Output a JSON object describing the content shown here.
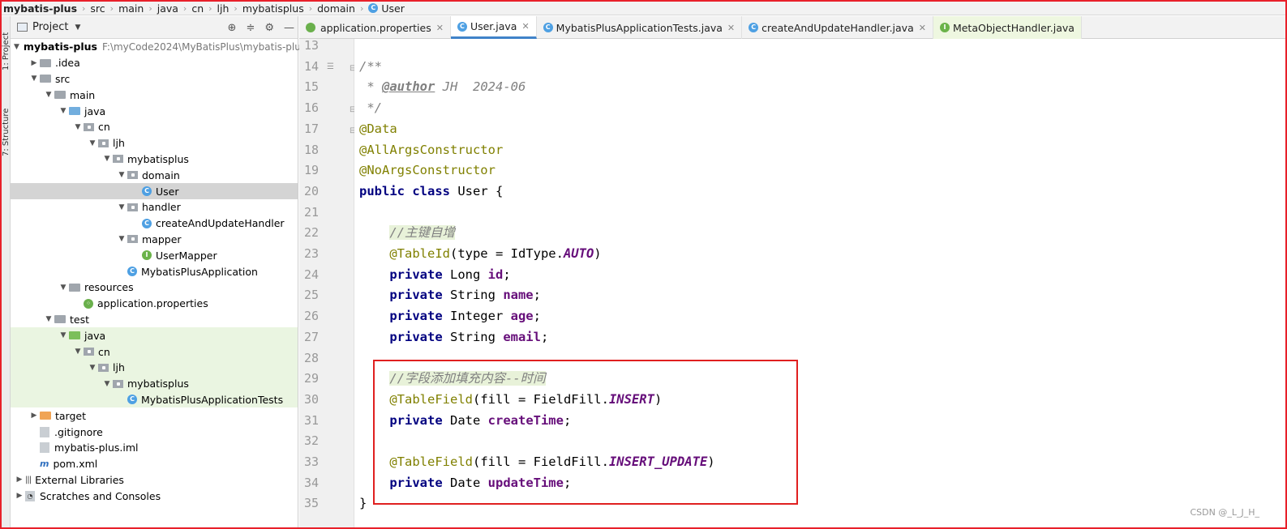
{
  "breadcrumb": [
    {
      "label": "mybatis-plus",
      "bold": true
    },
    {
      "label": "src"
    },
    {
      "label": "main"
    },
    {
      "label": "java"
    },
    {
      "label": "cn"
    },
    {
      "label": "ljh"
    },
    {
      "label": "mybatisplus"
    },
    {
      "label": "domain"
    },
    {
      "label": "User",
      "icon": "C"
    }
  ],
  "side_tabs": {
    "project": "1: Project",
    "structure": "7: Structure"
  },
  "project_panel": {
    "title": "Project",
    "tree": [
      {
        "label": "mybatis-plus",
        "hint": "F:\\myCode2024\\MyBatisPlus\\mybatis-plu",
        "depth": 0,
        "expand": "open",
        "icon": "folder",
        "bold": true
      },
      {
        "label": ".idea",
        "depth": 1,
        "expand": "closed",
        "icon": "folder"
      },
      {
        "label": "src",
        "depth": 1,
        "expand": "open",
        "icon": "folder"
      },
      {
        "label": "main",
        "depth": 2,
        "expand": "open",
        "icon": "folder"
      },
      {
        "label": "java",
        "depth": 3,
        "expand": "open",
        "icon": "folder-src"
      },
      {
        "label": "cn",
        "depth": 4,
        "expand": "open",
        "icon": "package"
      },
      {
        "label": "ljh",
        "depth": 5,
        "expand": "open",
        "icon": "package"
      },
      {
        "label": "mybatisplus",
        "depth": 6,
        "expand": "open",
        "icon": "package"
      },
      {
        "label": "domain",
        "depth": 7,
        "expand": "open",
        "icon": "package"
      },
      {
        "label": "User",
        "depth": 8,
        "expand": "none",
        "icon": "class",
        "selected": true
      },
      {
        "label": "handler",
        "depth": 7,
        "expand": "open",
        "icon": "package"
      },
      {
        "label": "createAndUpdateHandler",
        "depth": 8,
        "expand": "none",
        "icon": "class"
      },
      {
        "label": "mapper",
        "depth": 7,
        "expand": "open",
        "icon": "package"
      },
      {
        "label": "UserMapper",
        "depth": 8,
        "expand": "none",
        "icon": "interface"
      },
      {
        "label": "MybatisPlusApplication",
        "depth": 7,
        "expand": "none",
        "icon": "spring-class"
      },
      {
        "label": "resources",
        "depth": 3,
        "expand": "open",
        "icon": "folder-res"
      },
      {
        "label": "application.properties",
        "depth": 4,
        "expand": "none",
        "icon": "properties"
      },
      {
        "label": "test",
        "depth": 2,
        "expand": "open",
        "icon": "folder"
      },
      {
        "label": "java",
        "depth": 3,
        "expand": "open",
        "icon": "folder-test",
        "testbg": true
      },
      {
        "label": "cn",
        "depth": 4,
        "expand": "open",
        "icon": "package",
        "testbg": true
      },
      {
        "label": "ljh",
        "depth": 5,
        "expand": "open",
        "icon": "package",
        "testbg": true
      },
      {
        "label": "mybatisplus",
        "depth": 6,
        "expand": "open",
        "icon": "package",
        "testbg": true
      },
      {
        "label": "MybatisPlusApplicationTests",
        "depth": 7,
        "expand": "none",
        "icon": "spring-class",
        "testbg": true
      },
      {
        "label": "target",
        "depth": 1,
        "expand": "closed",
        "icon": "folder-target"
      },
      {
        "label": ".gitignore",
        "depth": 1,
        "expand": "none",
        "icon": "file"
      },
      {
        "label": "mybatis-plus.iml",
        "depth": 1,
        "expand": "none",
        "icon": "file"
      },
      {
        "label": "pom.xml",
        "depth": 1,
        "expand": "none",
        "icon": "maven"
      },
      {
        "label": "External Libraries",
        "depth": 0,
        "expand": "closed",
        "icon": "library"
      },
      {
        "label": "Scratches and Consoles",
        "depth": 0,
        "expand": "closed",
        "icon": "scratch"
      }
    ]
  },
  "editor_tabs": [
    {
      "label": "application.properties",
      "icon": "properties",
      "active": false
    },
    {
      "label": "User.java",
      "icon": "C",
      "active": true
    },
    {
      "label": "MybatisPlusApplicationTests.java",
      "icon": "C",
      "active": false
    },
    {
      "label": "createAndUpdateHandler.java",
      "icon": "C",
      "active": false
    },
    {
      "label": "MetaObjectHandler.java",
      "icon": "I",
      "active": false,
      "green": true
    }
  ],
  "line_numbers": [
    "13",
    "14",
    "15",
    "16",
    "17",
    "18",
    "19",
    "20",
    "21",
    "22",
    "23",
    "24",
    "25",
    "26",
    "27",
    "28",
    "29",
    "30",
    "31",
    "32",
    "33",
    "34",
    "35"
  ],
  "code_lines": [
    [],
    [
      {
        "t": "/**",
        "c": "cmt"
      }
    ],
    [
      {
        "t": " * ",
        "c": "cmt"
      },
      {
        "t": "@author",
        "c": "tag"
      },
      {
        "t": " JH  2024-06",
        "c": "cmt"
      }
    ],
    [
      {
        "t": " */",
        "c": "cmt"
      }
    ],
    [
      {
        "t": "@Data",
        "c": "ann"
      }
    ],
    [
      {
        "t": "@AllArgsConstructor",
        "c": "ann"
      }
    ],
    [
      {
        "t": "@NoArgsConstructor",
        "c": "ann"
      }
    ],
    [
      {
        "t": "public class ",
        "c": "kw"
      },
      {
        "t": "User {",
        "c": ""
      }
    ],
    [],
    [
      {
        "t": "    ",
        "c": ""
      },
      {
        "t": "//主键自增",
        "c": "cmt cmt-hl"
      }
    ],
    [
      {
        "t": "    ",
        "c": ""
      },
      {
        "t": "@TableId",
        "c": "ann"
      },
      {
        "t": "(type = IdType.",
        "c": ""
      },
      {
        "t": "AUTO",
        "c": "const"
      },
      {
        "t": ")",
        "c": ""
      }
    ],
    [
      {
        "t": "    ",
        "c": ""
      },
      {
        "t": "private ",
        "c": "kw"
      },
      {
        "t": "Long ",
        "c": ""
      },
      {
        "t": "id",
        "c": "fld"
      },
      {
        "t": ";",
        "c": ""
      }
    ],
    [
      {
        "t": "    ",
        "c": ""
      },
      {
        "t": "private ",
        "c": "kw"
      },
      {
        "t": "String ",
        "c": ""
      },
      {
        "t": "name",
        "c": "fld"
      },
      {
        "t": ";",
        "c": ""
      }
    ],
    [
      {
        "t": "    ",
        "c": ""
      },
      {
        "t": "private ",
        "c": "kw"
      },
      {
        "t": "Integer ",
        "c": ""
      },
      {
        "t": "age",
        "c": "fld"
      },
      {
        "t": ";",
        "c": ""
      }
    ],
    [
      {
        "t": "    ",
        "c": ""
      },
      {
        "t": "private ",
        "c": "kw"
      },
      {
        "t": "String ",
        "c": ""
      },
      {
        "t": "email",
        "c": "fld"
      },
      {
        "t": ";",
        "c": ""
      }
    ],
    [],
    [
      {
        "t": "    ",
        "c": ""
      },
      {
        "t": "//字段添加填充内容--时间",
        "c": "cmt cmt-hl"
      }
    ],
    [
      {
        "t": "    ",
        "c": ""
      },
      {
        "t": "@TableField",
        "c": "ann"
      },
      {
        "t": "(fill = FieldFill.",
        "c": ""
      },
      {
        "t": "INSERT",
        "c": "const"
      },
      {
        "t": ")",
        "c": ""
      }
    ],
    [
      {
        "t": "    ",
        "c": ""
      },
      {
        "t": "private ",
        "c": "kw"
      },
      {
        "t": "Date ",
        "c": ""
      },
      {
        "t": "createTime",
        "c": "fld"
      },
      {
        "t": ";",
        "c": ""
      }
    ],
    [],
    [
      {
        "t": "    ",
        "c": ""
      },
      {
        "t": "@TableField",
        "c": "ann"
      },
      {
        "t": "(fill = FieldFill.",
        "c": ""
      },
      {
        "t": "INSERT_UPDATE",
        "c": "const"
      },
      {
        "t": ")",
        "c": ""
      }
    ],
    [
      {
        "t": "    ",
        "c": ""
      },
      {
        "t": "private ",
        "c": "kw"
      },
      {
        "t": "Date ",
        "c": ""
      },
      {
        "t": "updateTime",
        "c": "fld"
      },
      {
        "t": ";",
        "c": ""
      }
    ],
    [
      {
        "t": "}",
        "c": ""
      }
    ]
  ],
  "watermark": "CSDN @_L_J_H_",
  "colors": {
    "highlight_box": "#e02020",
    "frame": "#e8202a",
    "keyword": "#000080",
    "annotation": "#808000",
    "field": "#660e7a",
    "comment": "#808080"
  }
}
